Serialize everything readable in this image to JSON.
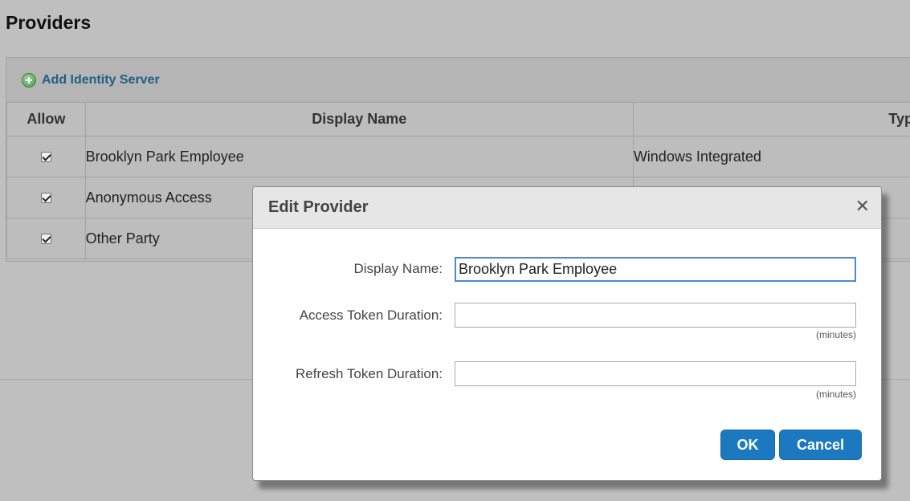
{
  "page": {
    "title": "Providers"
  },
  "toolbar": {
    "add_label": "Add Identity Server",
    "add_icon": "plus-circle-icon"
  },
  "table": {
    "columns": [
      "Allow",
      "Display Name",
      "Type"
    ],
    "rows": [
      {
        "allow": true,
        "name": "Brooklyn Park Employee",
        "type": "Windows Integrated"
      },
      {
        "allow": true,
        "name": "Anonymous Access",
        "type": ""
      },
      {
        "allow": true,
        "name": "Other Party",
        "type": ""
      }
    ]
  },
  "modal": {
    "title": "Edit Provider",
    "close_icon": "close-icon",
    "fields": {
      "display_name": {
        "label": "Display Name:",
        "value": "Brooklyn Park Employee"
      },
      "access_token": {
        "label": "Access Token Duration:",
        "value": "",
        "unit": "(minutes)"
      },
      "refresh_token": {
        "label": "Refresh Token Duration:",
        "value": "",
        "unit": "(minutes)"
      }
    },
    "buttons": {
      "ok": "OK",
      "cancel": "Cancel"
    }
  },
  "colors": {
    "background": "#bfbfbf",
    "link": "#1f5f86",
    "primary_button": "#1c79c0",
    "focus_border": "#4a8ad0"
  }
}
